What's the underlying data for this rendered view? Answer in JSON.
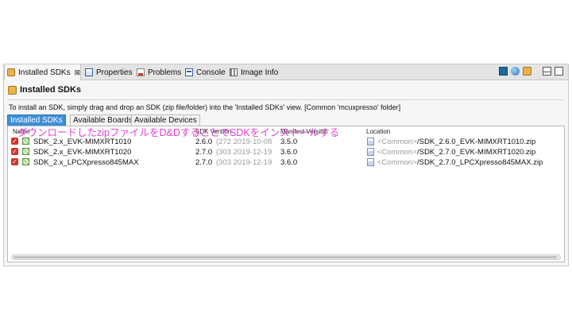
{
  "view_tabs": [
    {
      "label": "Installed SDKs",
      "icon": "sdk-icon",
      "active": true
    },
    {
      "label": "Properties",
      "icon": "properties-icon"
    },
    {
      "label": "Problems",
      "icon": "problems-icon"
    },
    {
      "label": "Console",
      "icon": "console-icon"
    },
    {
      "label": "Image Info",
      "icon": "image-info-icon"
    }
  ],
  "close_glyph": "⊠",
  "view": {
    "title": "Installed SDKs",
    "instructions": "To install an SDK, simply drag and drop an SDK (zip file/folder) into the 'Installed SDKs' view. [Common 'mcuxpresso' folder]"
  },
  "inner_tabs": [
    {
      "label": "Installed SDKs",
      "active": true
    },
    {
      "label": "Available Boards"
    },
    {
      "label": "Available Devices"
    }
  ],
  "table": {
    "columns": [
      "Name",
      "SDK Version",
      "Manifest Version",
      "Location"
    ],
    "rows": [
      {
        "name": "SDK_2.x_EVK-MIMXRT1010",
        "version": "2.6.0",
        "version_detail": "(272 2019-10-08",
        "manifest": "3.5.0",
        "loc_prefix": "<Common>",
        "loc_path": "/SDK_2.6.0_EVK-MIMXRT1010.zip"
      },
      {
        "name": "SDK_2.x_EVK-MIMXRT1020",
        "version": "2.7.0",
        "version_detail": "(303 2019-12-19",
        "manifest": "3.6.0",
        "loc_prefix": "<Common>",
        "loc_path": "/SDK_2.7.0_EVK-MIMXRT1020.zip"
      },
      {
        "name": "SDK_2.x_LPCXpresso845MAX",
        "version": "2.7.0",
        "version_detail": "(303 2019-12-19",
        "manifest": "3.6.0",
        "loc_prefix": "<Common>",
        "loc_path": "/SDK_2.7.0_LPCXpresso845MAX.zip"
      }
    ]
  },
  "annotation": "ダウンロードしたzipファイルをD&DすることでSDKをインストールする",
  "colors": {
    "annotation": "#e23fd3",
    "active_tab": "#3d8fd8",
    "checkbox": "#d3342a"
  }
}
